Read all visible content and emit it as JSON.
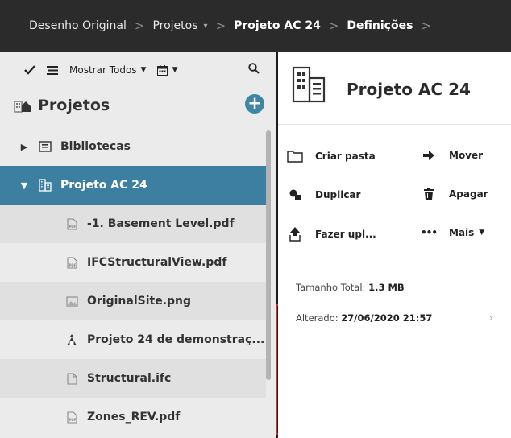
{
  "breadcrumb": {
    "items": [
      "Desenho Original",
      "Projetos",
      "Projeto AC 24",
      "Definições"
    ],
    "separator": ">",
    "dropdown_glyph": "▾"
  },
  "left_toolbar": {
    "check_icon": "checkmark-icon",
    "list_icon": "list-icon",
    "filter_label": "Mostrar Todos",
    "calendar_icon": "calendar-icon",
    "search_icon": "search-icon"
  },
  "left_panel": {
    "title": "Projetos",
    "add_glyph": "+",
    "items": [
      {
        "label": "Bibliotecas",
        "icon": "library-icon",
        "expander": "▶",
        "selected": false
      },
      {
        "label": "Projeto AC 24",
        "icon": "building-icon",
        "expander": "▼",
        "selected": true
      },
      {
        "label": "-1. Basement Level.pdf",
        "icon": "pdf-file-icon"
      },
      {
        "label": "IFCStructuralView.pdf",
        "icon": "pdf-file-icon"
      },
      {
        "label": "OriginalSite.png",
        "icon": "image-file-icon"
      },
      {
        "label": "Projeto 24 de demonstraç...",
        "icon": "project-file-icon"
      },
      {
        "label": "Structural.ifc",
        "icon": "file-icon"
      },
      {
        "label": "Zones_REV.pdf",
        "icon": "pdf-file-icon"
      }
    ]
  },
  "right_panel": {
    "title": "Projeto AC 24",
    "actions": {
      "create_folder": "Criar pasta",
      "move": "Mover",
      "duplicate": "Duplicar",
      "delete": "Apagar",
      "upload": "Fazer upl...",
      "more": "Mais",
      "more_glyph": "•••"
    },
    "total_size_label": "Tamanho Total:",
    "total_size_value": "1.3 MB",
    "modified_label": "Alterado:",
    "modified_value": "27/06/2020 21:57"
  },
  "colors": {
    "topbar": "#2b2b2b",
    "selected_row": "#3d7fa1",
    "add_button": "#3f86a5",
    "handle_outline": "#e12a2a"
  }
}
